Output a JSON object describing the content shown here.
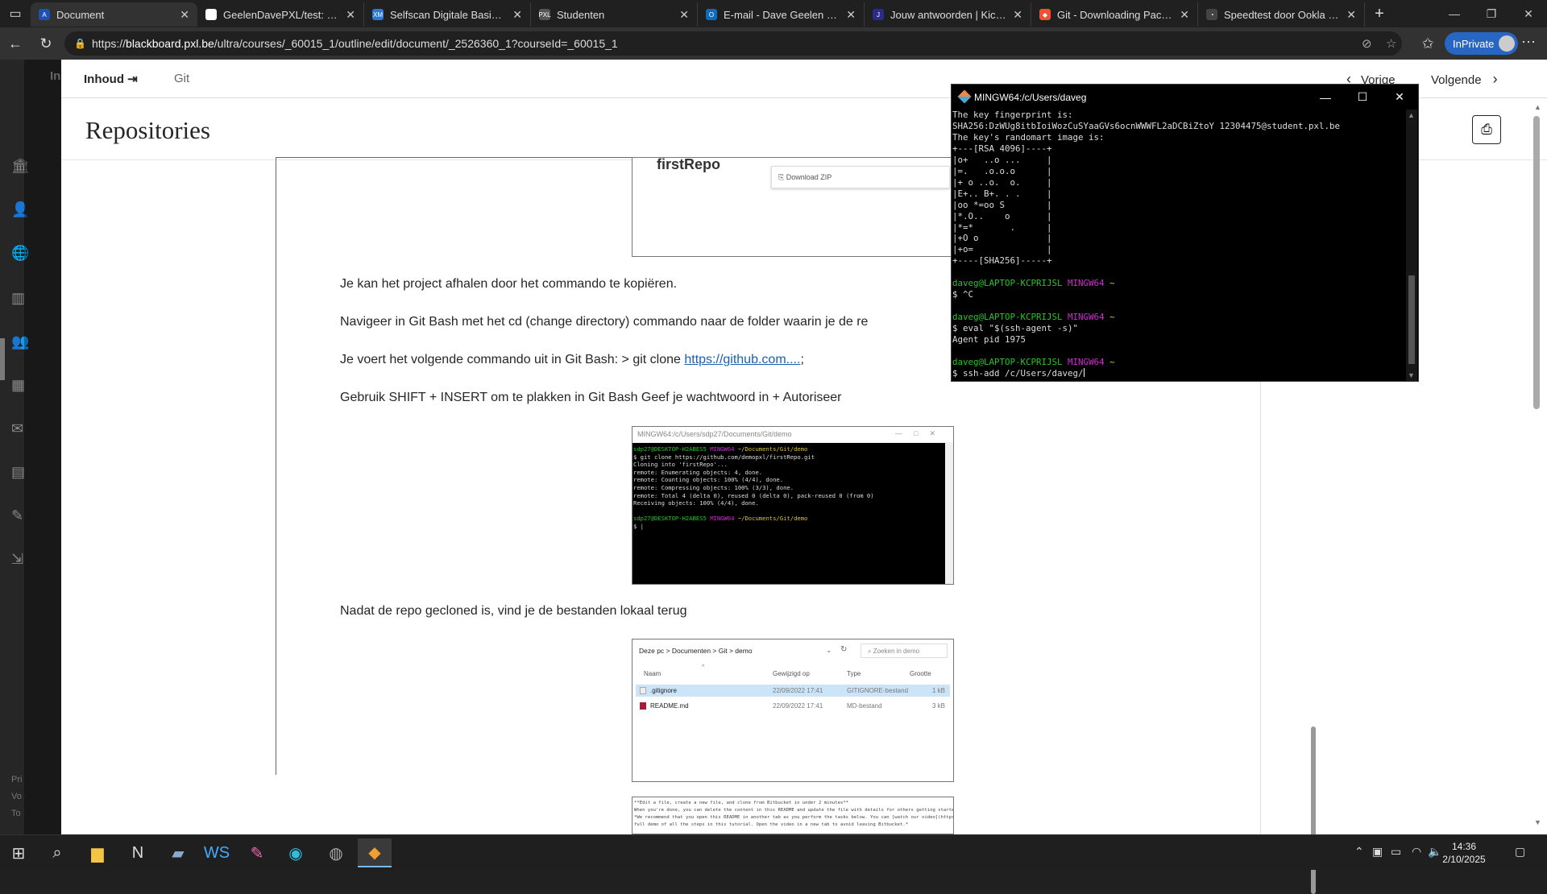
{
  "browser": {
    "tabs": [
      {
        "title": "Document",
        "color": "#1f4fb5",
        "glyph": "A"
      },
      {
        "title": "GeelenDavePXL/test: gewo",
        "color": "#ffffff",
        "glyph": "●"
      },
      {
        "title": "Selfscan Digitale Basisgelet",
        "color": "#2b78d8",
        "glyph": "XM"
      },
      {
        "title": "Studenten",
        "color": "#555555",
        "glyph": "PXL"
      },
      {
        "title": "E-mail - Dave Geelen - Outl",
        "color": "#0f6cbd",
        "glyph": "O"
      },
      {
        "title": "Jouw antwoorden | Kickstar",
        "color": "#2b2b8a",
        "glyph": "J"
      },
      {
        "title": "Git - Downloading Package",
        "color": "#f05133",
        "glyph": "◆"
      },
      {
        "title": "Speedtest door Ookla - De",
        "color": "#444444",
        "glyph": "◔"
      }
    ],
    "url_prefix": "https://",
    "url_host": "blackboard.pxl.be",
    "url_path": "/ultra/courses/_60015_1/outline/edit/document/_2526360_1?courseId=_60015_1",
    "inprivate_label": "InPrivate"
  },
  "panel": {
    "inhoud_label": "Inhoud",
    "breadcrumb": "Git",
    "prev_label": "Vorige",
    "next_label": "Volgende",
    "title": "Repositories",
    "bg_partial": "In"
  },
  "sidebar_bottom": [
    "Pri",
    "Vo",
    "To"
  ],
  "doc": {
    "img1_title": "firstRepo",
    "img1_download": "Download ZIP",
    "p1": "Je kan het project afhalen door het commando te kopiëren.",
    "p2": "Navigeer in Git Bash met het cd (change directory) commando naar de folder waarin je de re",
    "p3_text": "Je voert het volgende commando uit in Git Bash: > git clone ",
    "p3_link": "https://github.com....",
    "p3_end": ";",
    "p4": "Gebruik SHIFT + INSERT om te plakken in Git Bash Geef je wachtwoord in + Autoriseer",
    "p5": "Nadat de repo gecloned is, vind je de bestanden lokaal terug",
    "term_title": "MINGW64:/c/Users/sdp27/Documents/Git/demo",
    "term_prompt": "sdp27@DESKTOP-H2ABES5",
    "term_env": "MINGW64",
    "term_path": "~/Documents/Git/demo",
    "term_lines": [
      "$ git clone https://github.com/demopxl/firstRepo.git",
      "Cloning into 'firstRepo'...",
      "remote: Enumerating objects: 4, done.",
      "remote: Counting objects: 100% (4/4), done.",
      "remote: Compressing objects: 100% (3/3), done.",
      "remote: Total 4 (delta 0), reused 0 (delta 0), pack-reused 0 (from 0)",
      "Receiving objects: 100% (4/4), done."
    ],
    "term_end": "$ |",
    "explorer_path": "Deze pc  >  Documenten  >  Git  >  demo",
    "explorer_search": "Zoeken in demo",
    "explorer_cols": [
      "Naam",
      "Gewijzigd op",
      "Type",
      "Grootte"
    ],
    "explorer_rows": [
      {
        "name": ".gitignore",
        "date": "22/09/2022 17:41",
        "type": "GITIGNORE-bestand",
        "size": "1 kB"
      },
      {
        "name": "README.md",
        "date": "22/09/2022 17:41",
        "type": "MD-bestand",
        "size": "3 kB"
      }
    ],
    "readme_lines": [
      "**Edit a file, create a new file, and clone from Bitbucket in under 2 minutes**",
      "When you're done, you can delete the content in this README and update the file with details for others getting started wit",
      "*We recommend that you open this README in another tab as you perform the tasks below. You can [watch our video](https://y",
      "full demo of all the steps in this tutorial. Open the video in a new tab to avoid leaving Bitbucket.*"
    ]
  },
  "mingw": {
    "title": "MINGW64:/c/Users/daveg",
    "lines_before": "The key fingerprint is:\nSHA256:DzWUg8itbIoiWozCuSYaaGVs6ocnWWWFL2aDCBiZtoY 12304475@student.pxl.be\nThe key's randomart image is:\n+---[RSA 4096]----+\n|o+   ..o ...     |\n|=.   .o.o.o      |\n|+ o ..o.  o.     |\n|E+.. B+. . .     |\n|oo *=oo S        |\n|*.O..    o       |\n|*=*       .      |\n|+O o             |\n|+o=              |\n+----[SHA256]-----+\n",
    "user": "daveg@LAPTOP-KCPRIJSL",
    "env": "MINGW64",
    "tilde": "~",
    "cmd1": "$ ^C",
    "cmd2": "$ eval \"$(ssh-agent -s)\"",
    "out2": "Agent pid 1975",
    "cmd3": "$ ssh-add /c/Users/daveg/"
  },
  "taskbar": {
    "time": "14:36",
    "date": "2/10/2025"
  }
}
